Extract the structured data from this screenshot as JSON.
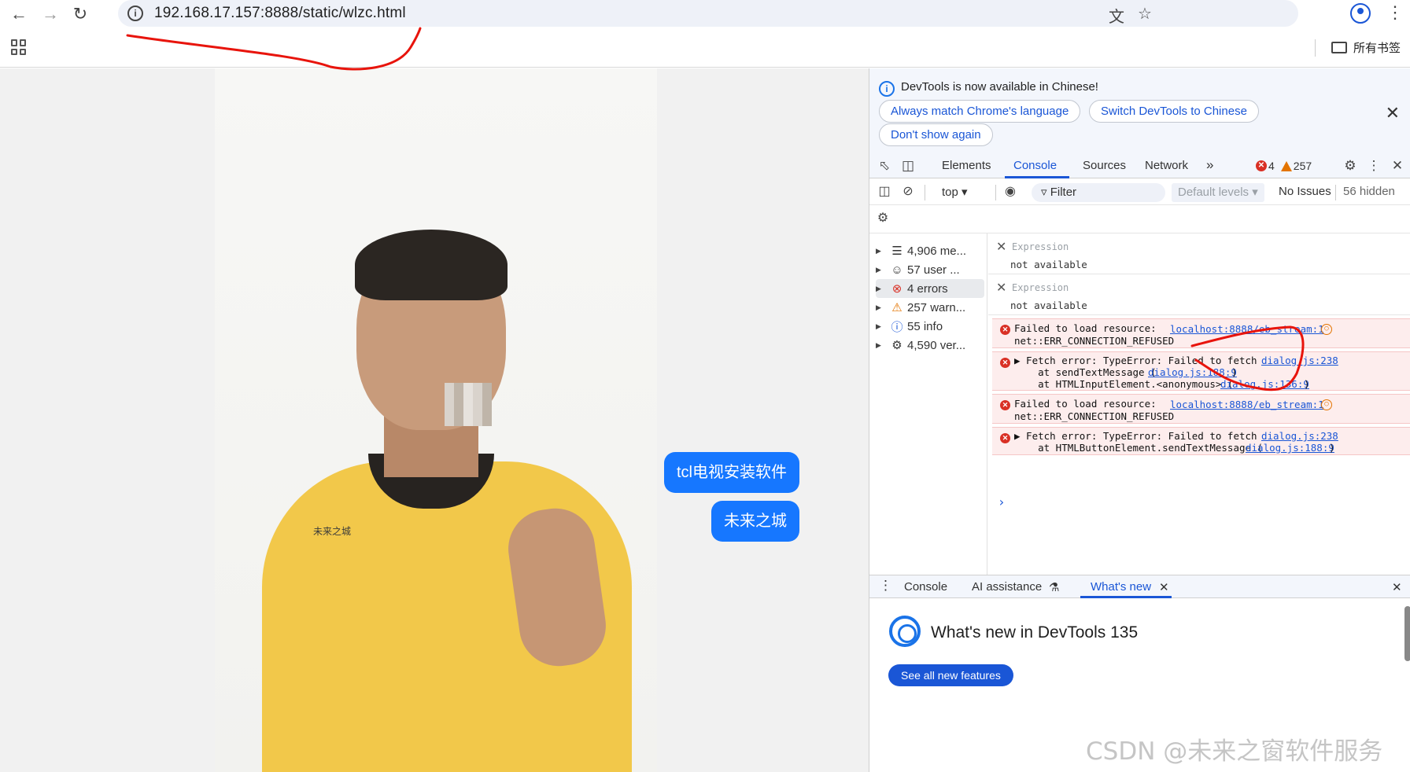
{
  "browser": {
    "url": "192.168.17.157:8888/static/wlzc.html",
    "bookmarks_folder": "所有书签"
  },
  "page": {
    "bubbles": [
      "tcl电视安装软件",
      "未来之城"
    ],
    "shirt_logo": "未来之城"
  },
  "devtools": {
    "banner": {
      "message": "DevTools is now available in Chinese!",
      "buttons": [
        "Always match Chrome's language",
        "Switch DevTools to Chinese",
        "Don't show again"
      ]
    },
    "tabs": [
      "Elements",
      "Console",
      "Sources",
      "Network"
    ],
    "active_tab": "Console",
    "error_count": "4",
    "warning_count": "257",
    "filter": {
      "context": "top",
      "placeholder": "Filter",
      "levels": "Default levels",
      "issues": "No Issues",
      "hidden": "56 hidden"
    },
    "sidebar": [
      {
        "label": "4,906 me...",
        "icon": "list-icon"
      },
      {
        "label": "57 user ...",
        "icon": "user-icon"
      },
      {
        "label": "4 errors",
        "icon": "error-icon"
      },
      {
        "label": "257 warn...",
        "icon": "warning-icon"
      },
      {
        "label": "55 info",
        "icon": "info-icon"
      },
      {
        "label": "4,590 ver...",
        "icon": "bug-icon"
      }
    ],
    "expressions": [
      {
        "label": "Expression",
        "value": "not available"
      },
      {
        "label": "Expression",
        "value": "not available"
      }
    ],
    "messages": [
      {
        "lines": [
          "Failed to load resource:",
          "net::ERR_CONNECTION_REFUSED"
        ],
        "link": "localhost:8888/eb_stream:1"
      },
      {
        "lines": [
          "▶ Fetch error: TypeError: Failed to fetch",
          "    at sendTextMessage (",
          "    at HTMLInputElement.<anonymous> ("
        ],
        "link": "dialog.js:238",
        "sublinks": [
          "dialog.js:188:9",
          "dialog.js:136:9"
        ]
      },
      {
        "lines": [
          "Failed to load resource:",
          "net::ERR_CONNECTION_REFUSED"
        ],
        "link": "localhost:8888/eb_stream:1"
      },
      {
        "lines": [
          "▶ Fetch error: TypeError: Failed to fetch",
          "    at HTMLButtonElement.sendTextMessage ("
        ],
        "link": "dialog.js:238",
        "sublinks": [
          "dialog.js:188:9"
        ]
      }
    ],
    "drawer": {
      "tabs": [
        "Console",
        "AI assistance",
        "What's new"
      ],
      "active_tab": "What's new",
      "title": "What's new in DevTools 135",
      "button": "See all new features"
    },
    "watermark": "CSDN @未来之窗软件服务"
  },
  "colors": {
    "accent": "#1a56d6",
    "bubble": "#1677ff",
    "error": "#d93025",
    "warning": "#e37400",
    "error_bg": "#fdeded"
  }
}
